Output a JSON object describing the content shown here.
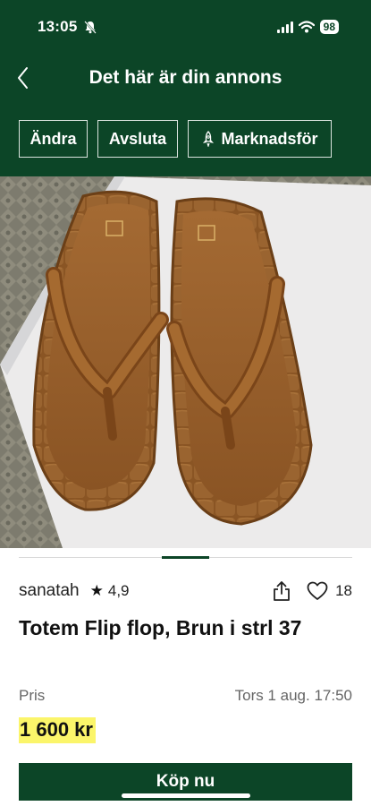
{
  "status_bar": {
    "time": "13:05",
    "battery": "98"
  },
  "nav": {
    "title": "Det här är din annons"
  },
  "actions": {
    "edit": "Ändra",
    "end": "Avsluta",
    "promote": "Marknadsför"
  },
  "seller": {
    "name": "sanatah",
    "star": "★",
    "rating": "4,9",
    "likes": "18"
  },
  "listing": {
    "title": "Totem Flip flop, Brun i strl 37",
    "price_label": "Pris",
    "date": "Tors 1 aug. 17:50",
    "price": "1 600 kr"
  },
  "buy_label": "Köp nu",
  "colors": {
    "brand_green": "#0c4527",
    "price_highlight": "#fbf56a"
  },
  "icons": [
    "bell-off-icon",
    "signal-icon",
    "wifi-icon",
    "battery-icon",
    "back-chevron-icon",
    "rocket-icon",
    "share-icon",
    "heart-icon"
  ]
}
